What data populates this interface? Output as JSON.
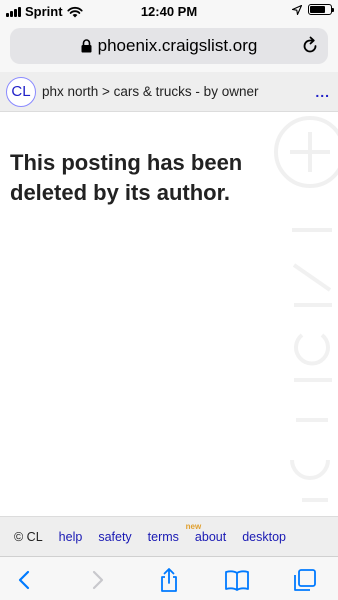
{
  "status_bar": {
    "carrier": "Sprint",
    "time": "12:40 PM",
    "battery_level": 0.75
  },
  "browser": {
    "url": "phoenix.craigslist.org"
  },
  "header": {
    "logo": "CL",
    "breadcrumb": "phx north > cars & trucks - by owner",
    "menu": "..."
  },
  "main": {
    "message": "This posting has been deleted by its author."
  },
  "footer": {
    "copyright": "© CL",
    "links": [
      "help",
      "safety",
      "terms",
      "about",
      "desktop"
    ],
    "new_badge": "new"
  },
  "toolbar": {
    "icons": [
      "back-icon",
      "forward-icon",
      "share-icon",
      "bookmarks-icon",
      "tabs-icon"
    ]
  },
  "colors": {
    "link": "#1a1ab4",
    "new_badge": "#e0a030",
    "accent": "#007aff"
  }
}
